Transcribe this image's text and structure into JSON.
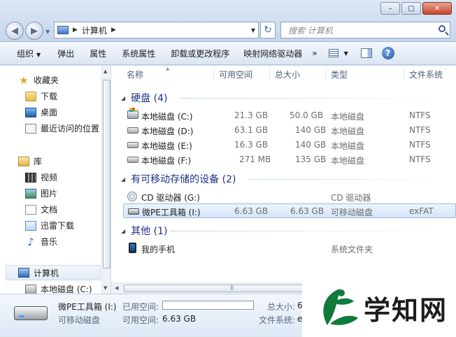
{
  "window": {
    "min_glyph": "–",
    "max_glyph": "□",
    "close_glyph": "✕"
  },
  "address": {
    "crumb": "计算机",
    "search_placeholder": "搜索 计算机"
  },
  "toolbar": {
    "items": [
      "组织",
      "弹出",
      "属性",
      "系统属性",
      "卸载或更改程序",
      "映射网络驱动器"
    ],
    "more": "»"
  },
  "nav": {
    "favorites": "收藏夹",
    "downloads": "下载",
    "desktop": "桌面",
    "recent": "最近访问的位置",
    "library": "库",
    "video": "视频",
    "pictures": "图片",
    "documents": "文档",
    "xunlei": "迅雷下载",
    "music": "音乐",
    "computer": "计算机",
    "local_c": "本地磁盘 (C:)"
  },
  "columns": {
    "name": "名称",
    "free": "可用空间",
    "total": "总大小",
    "type": "类型",
    "fs": "文件系统"
  },
  "groups": {
    "disks": "硬盘 (4)",
    "removable": "有可移动存储的设备 (2)",
    "other": "其他 (1)"
  },
  "disks": [
    {
      "name": "本地磁盘 (C:)",
      "free": "21.3 GB",
      "total": "50.0 GB",
      "type": "本地磁盘",
      "fs": "NTFS"
    },
    {
      "name": "本地磁盘 (D:)",
      "free": "63.1 GB",
      "total": "140 GB",
      "type": "本地磁盘",
      "fs": "NTFS"
    },
    {
      "name": "本地磁盘 (E:)",
      "free": "16.3 GB",
      "total": "140 GB",
      "type": "本地磁盘",
      "fs": "NTFS"
    },
    {
      "name": "本地磁盘 (F:)",
      "free": "271 MB",
      "total": "135 GB",
      "type": "本地磁盘",
      "fs": "NTFS"
    }
  ],
  "removable": [
    {
      "name": "CD 驱动器 (G:)",
      "free": "",
      "total": "",
      "type": "CD 驱动器",
      "fs": ""
    },
    {
      "name": "微PE工具箱 (I:)",
      "free": "6.63 GB",
      "total": "6.63 GB",
      "type": "可移动磁盘",
      "fs": "exFAT"
    }
  ],
  "other": [
    {
      "name": "我的手机",
      "type": "系统文件夹"
    }
  ],
  "details": {
    "name": "微PE工具箱 (I:)",
    "type": "可移动磁盘",
    "used_label": "已用空间:",
    "free_label": "可用空间:",
    "free_value": "6.63 GB",
    "total_label": "总大小:",
    "total_value": "6.",
    "fs_label": "文件系统:",
    "fs_value": "ex",
    "used_fraction": 0
  },
  "watermark": {
    "text": "学知网"
  },
  "colors": {
    "group_heading": "#1e3287",
    "selection": "#d6e5f8",
    "watermark_green": "#0f7a3c"
  }
}
